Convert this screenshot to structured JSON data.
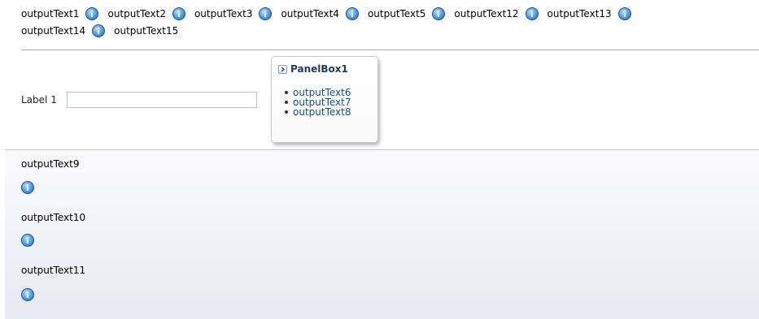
{
  "top_row": {
    "line1": [
      "outputText1",
      "outputText2",
      "outputText3",
      "outputText4",
      "outputText5",
      "outputText12",
      "outputText13"
    ],
    "line2": [
      "outputText14",
      "outputText15"
    ]
  },
  "form": {
    "label": "Label 1",
    "input_value": ""
  },
  "panelbox": {
    "title": "PanelBox1",
    "items": [
      "outputText6",
      "outputText7",
      "outputText8"
    ]
  },
  "lower": {
    "items": [
      "outputText9",
      "outputText10",
      "outputText11"
    ]
  },
  "icons": {
    "info": "info-icon",
    "toggle": "chevron-right-icon"
  },
  "colors": {
    "separator": "#a9a9c7",
    "panel_title": "#1f3a63",
    "panel_link": "#0f4e8a",
    "info_blue": "#1f63c9"
  }
}
